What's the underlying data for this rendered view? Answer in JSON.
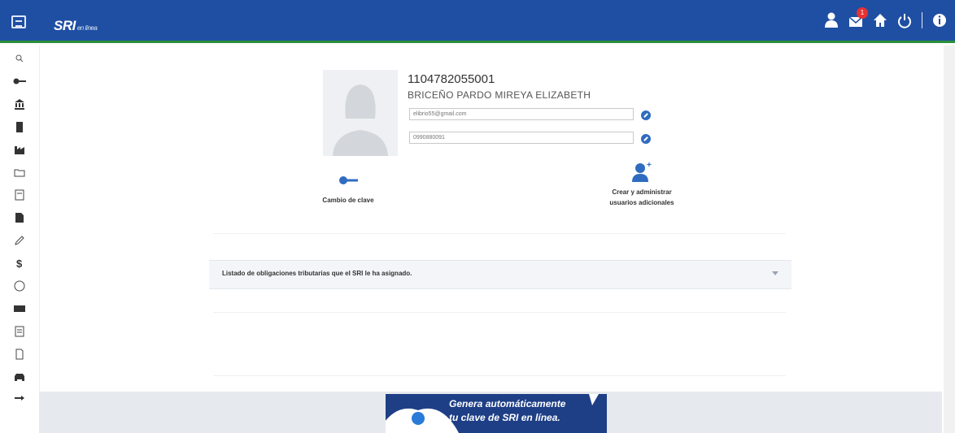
{
  "app": {
    "logo": "SRI",
    "logo_sub": "en línea"
  },
  "header": {
    "notification_count": "1",
    "icons": [
      "user-icon",
      "mail-icon",
      "home-icon",
      "power-icon",
      "info-icon"
    ]
  },
  "sidebar": {
    "icons": [
      "search-icon",
      "key-icon",
      "bank-icon",
      "building-icon",
      "factory-icon",
      "folder-icon",
      "calculator-icon",
      "document-icon",
      "pencil-icon",
      "dollar-icon",
      "coin-icon",
      "money-icon",
      "archive-icon",
      "file-icon",
      "car-icon",
      "logout-icon"
    ]
  },
  "profile": {
    "ruc": "1104782055001",
    "name": "BRICEÑO PARDO MIREYA ELIZABETH",
    "email": "elibrio55@gmail.com",
    "phone": "0990880091"
  },
  "actions": {
    "change_password": "Cambio de clave",
    "additional_users_line1": "Crear y administrar",
    "additional_users_line2": "usuarios adicionales"
  },
  "obligations": {
    "title": "Listado de obligaciones tributarias que el SRI le ha asignado."
  },
  "banner": {
    "line1": "Genera automáticamente",
    "line2": "tu clave de SRI en línea."
  },
  "colors": {
    "header": "#1f4fa3",
    "accent": "#2f6cbf",
    "header_line": "#2a8f3a"
  }
}
